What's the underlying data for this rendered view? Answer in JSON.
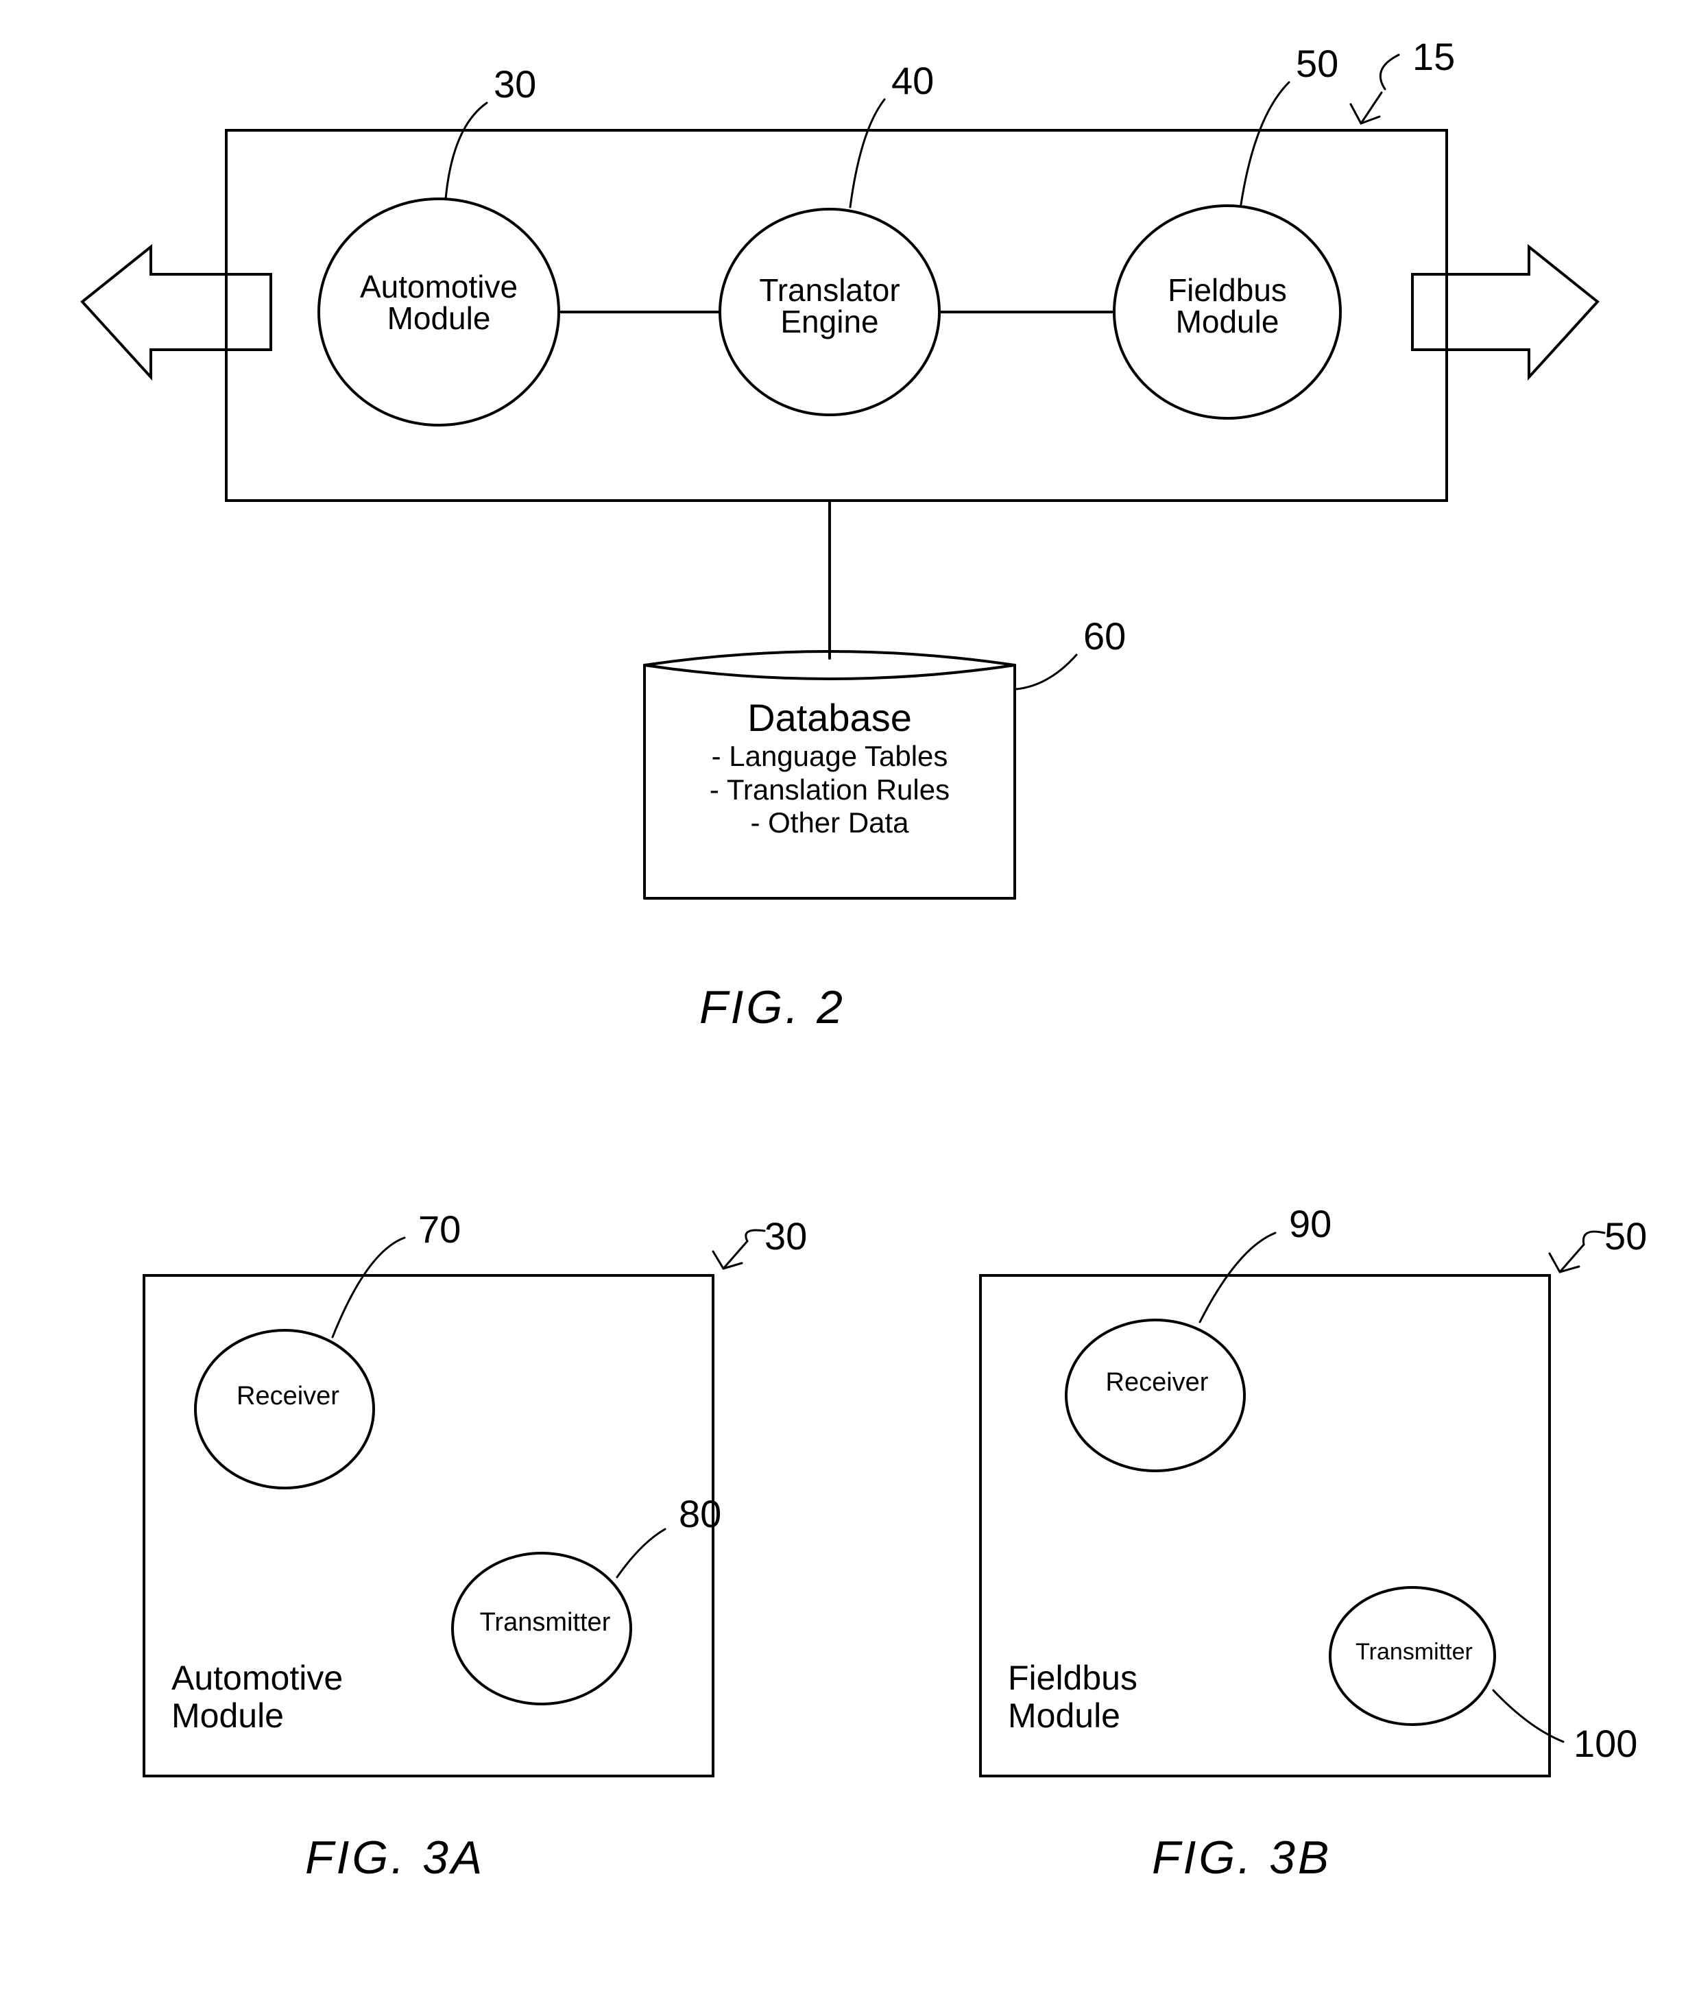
{
  "fig2": {
    "label": "FIG. 2",
    "refs": {
      "main": "15",
      "automotive": "30",
      "translator": "40",
      "fieldbus": "50",
      "database": "60"
    },
    "nodes": {
      "automotive": {
        "line1": "Automotive",
        "line2": "Module"
      },
      "translator": {
        "line1": "Translator",
        "line2": "Engine"
      },
      "fieldbus": {
        "line1": "Fieldbus",
        "line2": "Module"
      }
    },
    "database": {
      "title": "Database",
      "item1": "- Language Tables",
      "item2": "- Translation Rules",
      "item3": "- Other Data"
    }
  },
  "fig3a": {
    "label": "FIG. 3A",
    "refs": {
      "box": "30",
      "receiver": "70",
      "transmitter": "80"
    },
    "title_line1": "Automotive",
    "title_line2": "Module",
    "receiver": "Receiver",
    "transmitter": "Transmitter"
  },
  "fig3b": {
    "label": "FIG. 3B",
    "refs": {
      "box": "50",
      "receiver": "90",
      "transmitter": "100"
    },
    "title_line1": "Fieldbus",
    "title_line2": "Module",
    "receiver": "Receiver",
    "transmitter": "Transmitter"
  }
}
